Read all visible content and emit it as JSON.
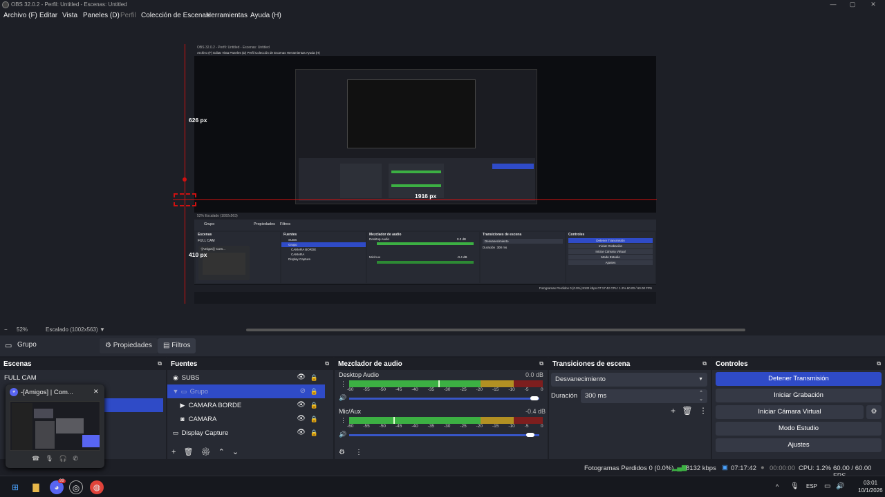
{
  "window": {
    "title": "OBS 32.0.2 - Perfil: Untitled - Escenas: Untitled",
    "minimize": "—",
    "maximize": "▢",
    "close": "✕"
  },
  "menu": [
    {
      "label": "Archivo (F)"
    },
    {
      "label": "Editar"
    },
    {
      "label": "Vista"
    },
    {
      "label": "Paneles (D)"
    },
    {
      "label": "Perfil"
    },
    {
      "label": "Colección de Escenas"
    },
    {
      "label": "Herramientas"
    },
    {
      "label": "Ayuda (H)"
    }
  ],
  "preview": {
    "height_label": "626 px",
    "width_label": "1916 px",
    "left_label": "410 px",
    "inner_title": "OBS 32.0.2 - Perfil: Untitled - Escenas: Untitled",
    "inner_menu": "Archivo (F)   Editar   Vista   Paneles (D)   Perfil   Colección de Escenas   Herramientas   Ayuda (H)",
    "inner_zoom": "52%   Escalado (1002x563)",
    "inner_scenes_title": "Escenas",
    "inner_scene_item": "FULL CAM",
    "inner_sources_title": "Fuentes",
    "inner_sources": [
      "SUBS",
      "Grupo",
      "CAMARA BORDE",
      "CAMARA",
      "Display Capture"
    ],
    "inner_mixer_title": "Mezclador de audio",
    "inner_trans_title": "Transiciones de escena",
    "inner_trans_value": "Desvanecimiento",
    "inner_duration": "Duración",
    "inner_duration_value": "300 ms",
    "inner_controls_title": "Controles",
    "inner_controls": [
      "Detener Transmisión",
      "Iniciar Grabación",
      "Iniciar Cámara Virtual",
      "Modo Estudio",
      "Ajustes"
    ],
    "inner_status": "Fotogramas Perdidos 0 (0.0%)   8132 kbps   07:17:42   CPU: 1.2%   60.00 / 60.00 FPS",
    "inner_popup": "-[Amigos] | Com...",
    "inner_grupo": "Grupo",
    "inner_props": "Propiedades",
    "inner_filters": "Filtros",
    "inner_desktop": "Desktop Audio",
    "inner_mic": "Mic/Aux",
    "inner_desktop_db": "0.0 dB",
    "inner_mic_db": "-0.4 dB"
  },
  "zoombar": {
    "minus": "−",
    "zoom": "52%",
    "scale": "Escalado (1002x563)",
    "arrow": "▼"
  },
  "toolbar": {
    "source": "Grupo",
    "properties": "Propiedades",
    "filters": "Filtros"
  },
  "scenes": {
    "title": "Escenas",
    "items": [
      "FULL CAM"
    ]
  },
  "sources": {
    "title": "Fuentes",
    "items": [
      {
        "label": "SUBS",
        "icon": "globe-icon"
      },
      {
        "label": "Grupo",
        "icon": "folder-icon"
      },
      {
        "label": "CAMARA BORDE",
        "icon": "play-icon"
      },
      {
        "label": "CAMARA",
        "icon": "camera-icon"
      },
      {
        "label": "Display Capture",
        "icon": "monitor-icon"
      }
    ]
  },
  "mixer": {
    "title": "Mezclador de audio",
    "channels": [
      {
        "name": "Desktop Audio",
        "db": "0.0 dB",
        "level": 0.46,
        "volume": 0.98
      },
      {
        "name": "Mic/Aux",
        "db": "-0.4 dB",
        "level": 0.23,
        "volume": 0.96
      }
    ],
    "ticks": [
      "-60",
      "-55",
      "-50",
      "-45",
      "-40",
      "-35",
      "-30",
      "-25",
      "-20",
      "-15",
      "-10",
      "-5",
      "0"
    ]
  },
  "transitions": {
    "title": "Transiciones de escena",
    "selected": "Desvanecimiento",
    "duration_label": "Duración",
    "duration_value": "300 ms"
  },
  "controls": {
    "title": "Controles",
    "stop_stream": "Detener Transmisión",
    "start_recording": "Iniciar Grabación",
    "start_virtualcam": "Iniciar Cámara Virtual",
    "studio_mode": "Modo Estudio",
    "settings": "Ajustes"
  },
  "status": {
    "dropped": "Fotogramas Perdidos 0 (0.0%)",
    "bitrate": "8132 kbps",
    "stream_time": "07:17:42",
    "rec_time": "00:00:00",
    "cpu": "CPU: 1.2%",
    "fps": "60.00 / 60.00 FPS"
  },
  "popup": {
    "title": "-[Amigos] | Com...",
    "close": "✕"
  },
  "taskbar": {
    "lang": "ESP",
    "time": "03:01",
    "date": "10/1/2026",
    "chevron": "^",
    "discord_badge": "99"
  },
  "colors": {
    "accent": "#2f4bc7",
    "red_guides": "#d01010",
    "meter_green": "#3cb043",
    "meter_yellow": "#c8a020",
    "meter_red": "#8a1a1a"
  }
}
